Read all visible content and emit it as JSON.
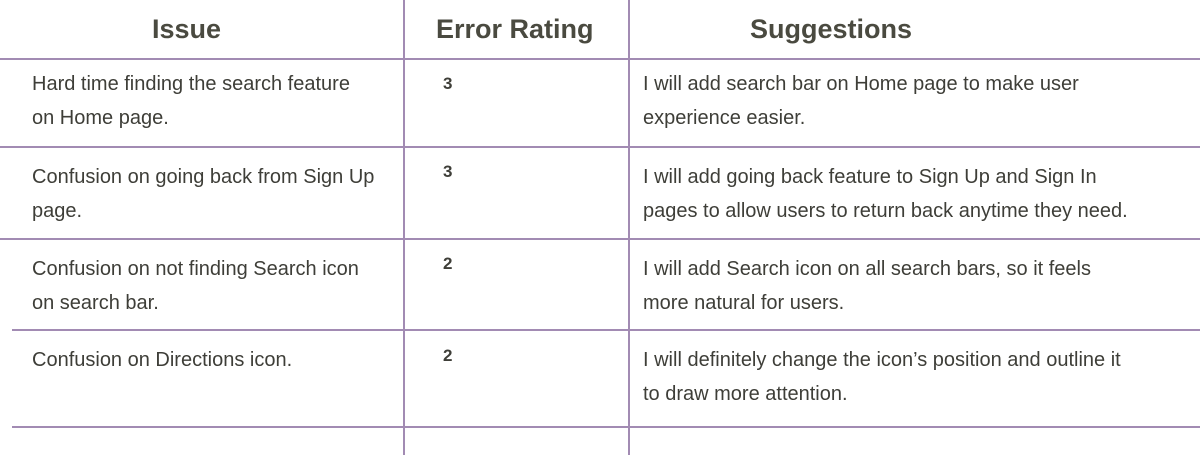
{
  "table": {
    "headers": {
      "issue": "Issue",
      "rating": "Error Rating",
      "suggestions": "Suggestions"
    },
    "rows": [
      {
        "issue_line1": "Hard time finding the search feature",
        "issue_line2": "on Home page.",
        "rating": "3",
        "suggestion_line1": "I will add search bar on Home page to make user",
        "suggestion_line2": "experience easier."
      },
      {
        "issue_line1": "Confusion on going back from Sign Up",
        "issue_line2": "page.",
        "rating": "3",
        "suggestion_line1": "I will add going back feature to Sign Up and Sign In",
        "suggestion_line2": "pages to allow users to return back anytime they need."
      },
      {
        "issue_line1": "Confusion on not finding Search icon",
        "issue_line2": "on search bar.",
        "rating": "2",
        "suggestion_line1": "I will add Search icon on all search bars, so it feels",
        "suggestion_line2": "more natural for users."
      },
      {
        "issue_line1": "Confusion on Directions icon.",
        "issue_line2": "",
        "rating": "2",
        "suggestion_line1": "I will definitely change the icon’s position and outline it",
        "suggestion_line2": "to draw more attention."
      }
    ]
  },
  "colors": {
    "rule": "#a28bb3",
    "header_text": "#4a4a40",
    "body_text": "#3e3e38"
  }
}
